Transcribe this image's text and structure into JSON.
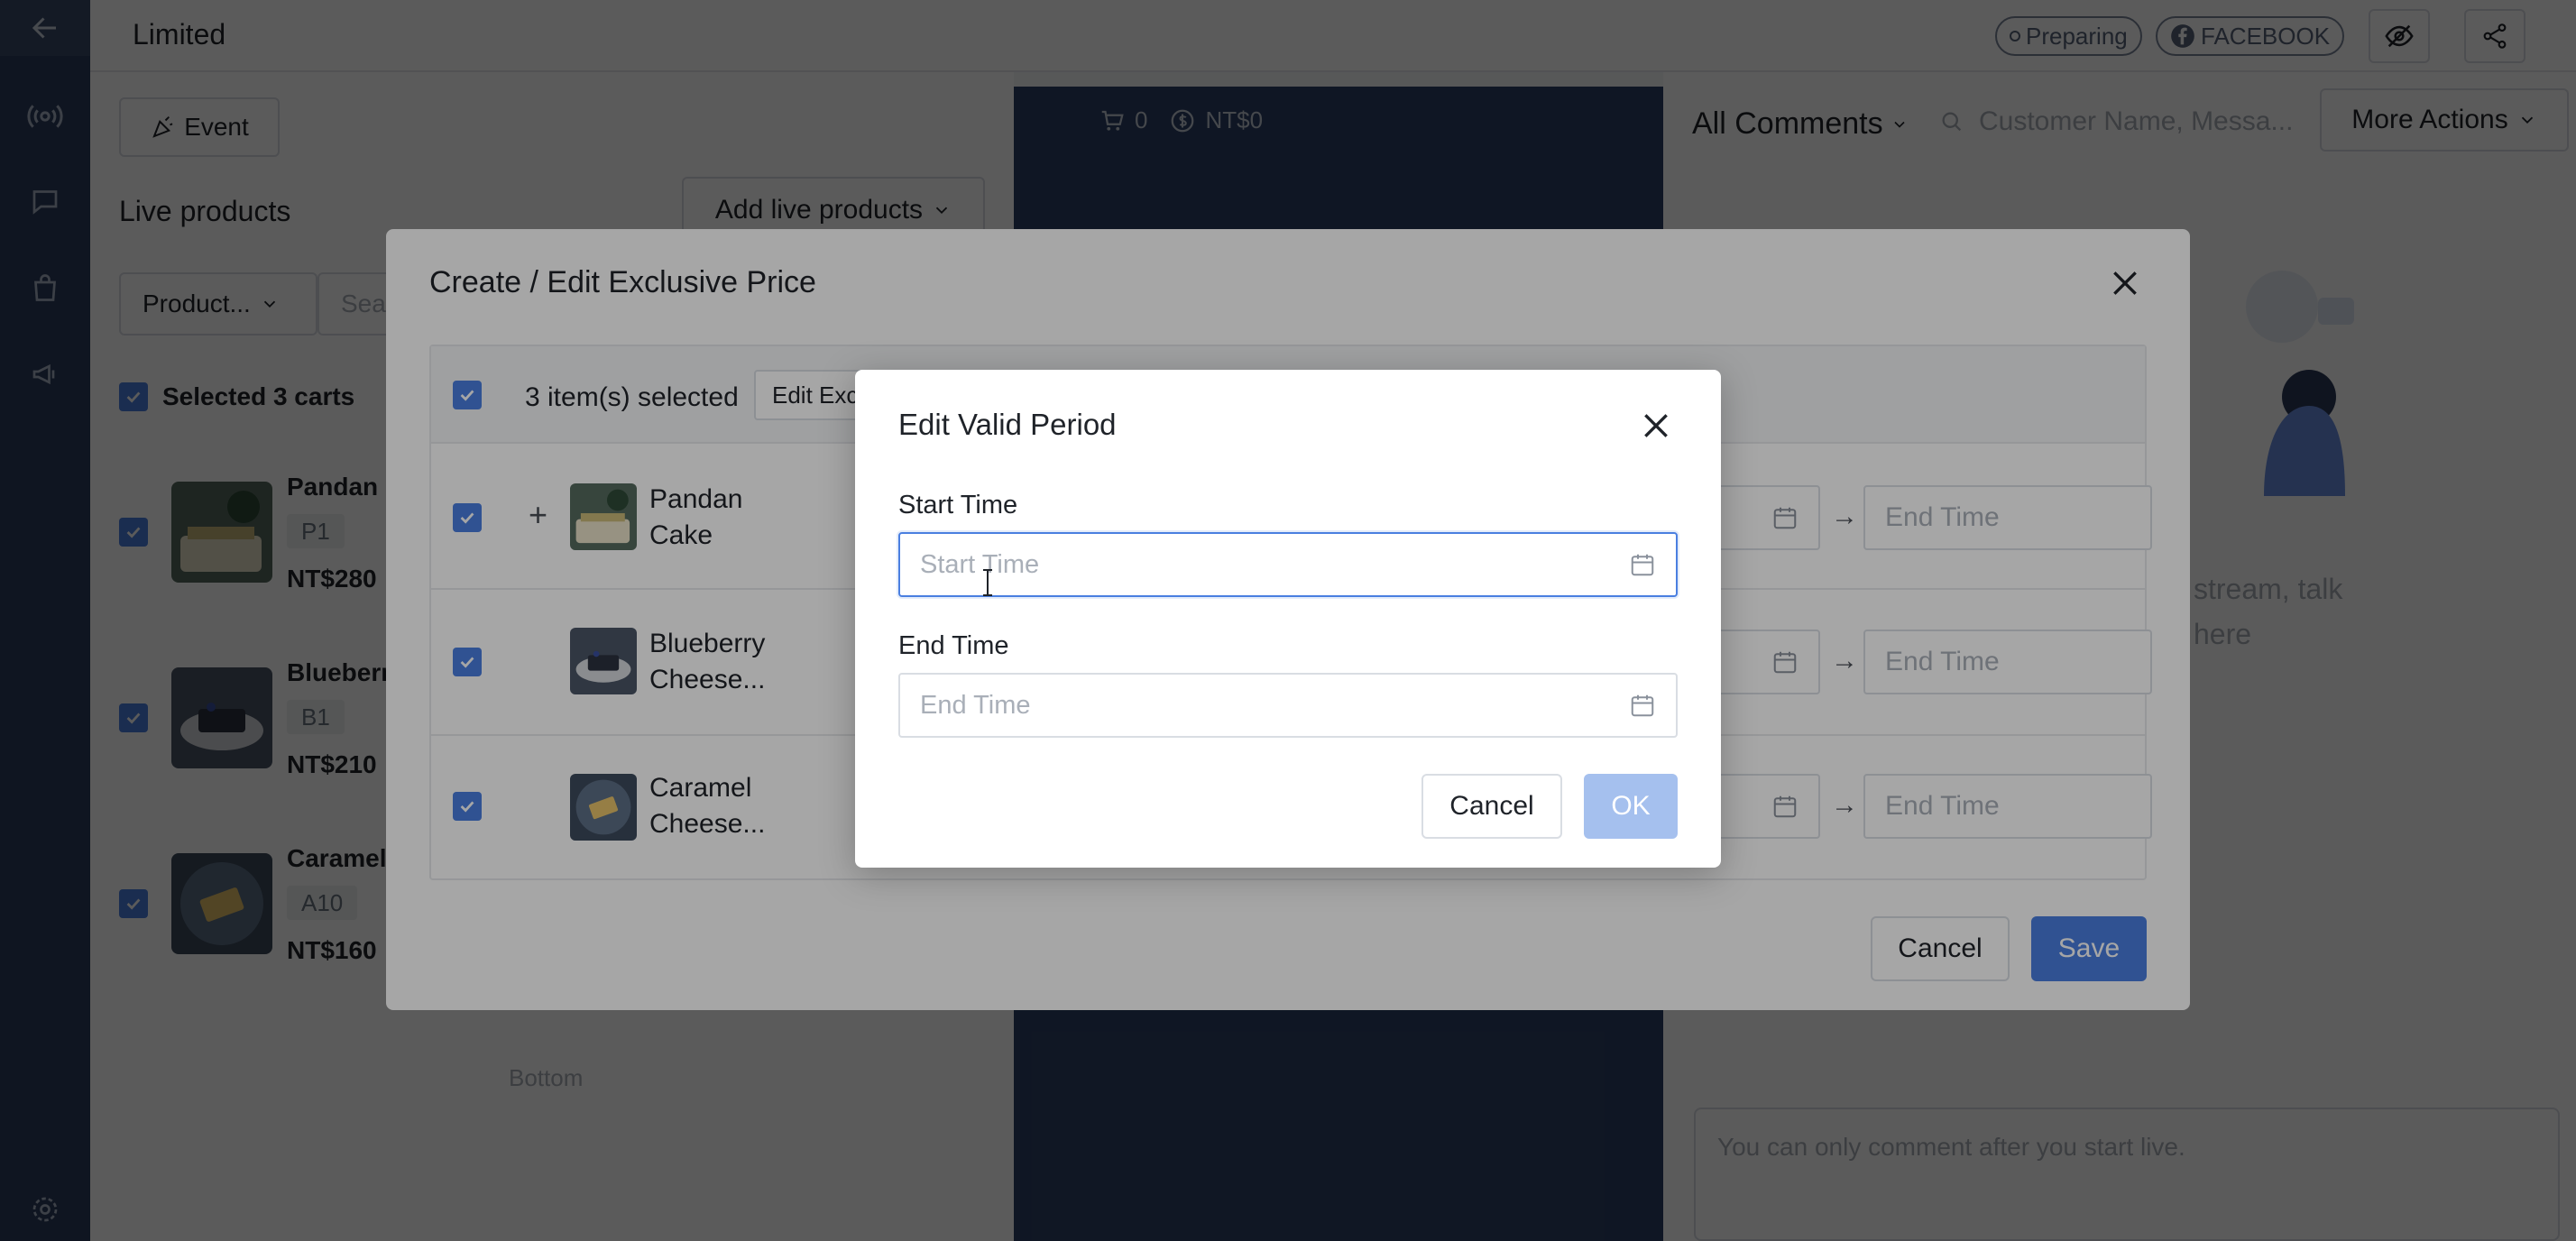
{
  "app": {
    "title": "Limited",
    "status_pill": "Preparing",
    "platform_pill": "FACEBOOK"
  },
  "colors": {
    "primary": "#4a7fe0",
    "sidebar": "#2c3d5e",
    "video": "#2d4066",
    "disabled_primary": "#a5c0ee"
  },
  "left_panel": {
    "event_button": "Event",
    "live_products_title": "Live products",
    "add_live_products": "Add live products",
    "product_filter": "Product...",
    "search_placeholder": "Sear",
    "selected_carts": "Selected 3 carts",
    "products": [
      {
        "name": "Pandan",
        "code": "P1",
        "price": "NT$280"
      },
      {
        "name": "Bluebern",
        "code": "B1",
        "price": "NT$210"
      },
      {
        "name": "Caramel",
        "code": "A10",
        "price": "NT$160"
      }
    ],
    "bottom_label": "Bottom"
  },
  "video": {
    "cart_count": "0",
    "amount": "NT$0"
  },
  "right_panel": {
    "all_comments": "All Comments",
    "search_placeholder": "Customer Name, Messa...",
    "more_actions": "More Actions",
    "empty_line1": "stream, talk",
    "empty_line2": "here",
    "comment_placeholder": "You can only comment after you start live."
  },
  "exclusive_modal": {
    "title": "Create / Edit Exclusive Price",
    "items_selected": "3 item(s) selected",
    "edit_exclusive": "Edit Exclusive",
    "rows": [
      {
        "name_line1": "Pandan",
        "name_line2": "Cake",
        "end_placeholder": "End Time"
      },
      {
        "name_line1": "Blueberry",
        "name_line2": "Cheese...",
        "end_placeholder": "End Time"
      },
      {
        "name_line1": "Caramel",
        "name_line2": "Cheese...",
        "end_placeholder": "End Time"
      }
    ],
    "arrow": "→",
    "plus": "+",
    "cancel": "Cancel",
    "save": "Save"
  },
  "period_modal": {
    "title": "Edit Valid Period",
    "start_label": "Start Time",
    "start_placeholder": "Start Time",
    "start_value": "",
    "end_label": "End Time",
    "end_placeholder": "End Time",
    "end_value": "",
    "cancel": "Cancel",
    "ok": "OK"
  }
}
